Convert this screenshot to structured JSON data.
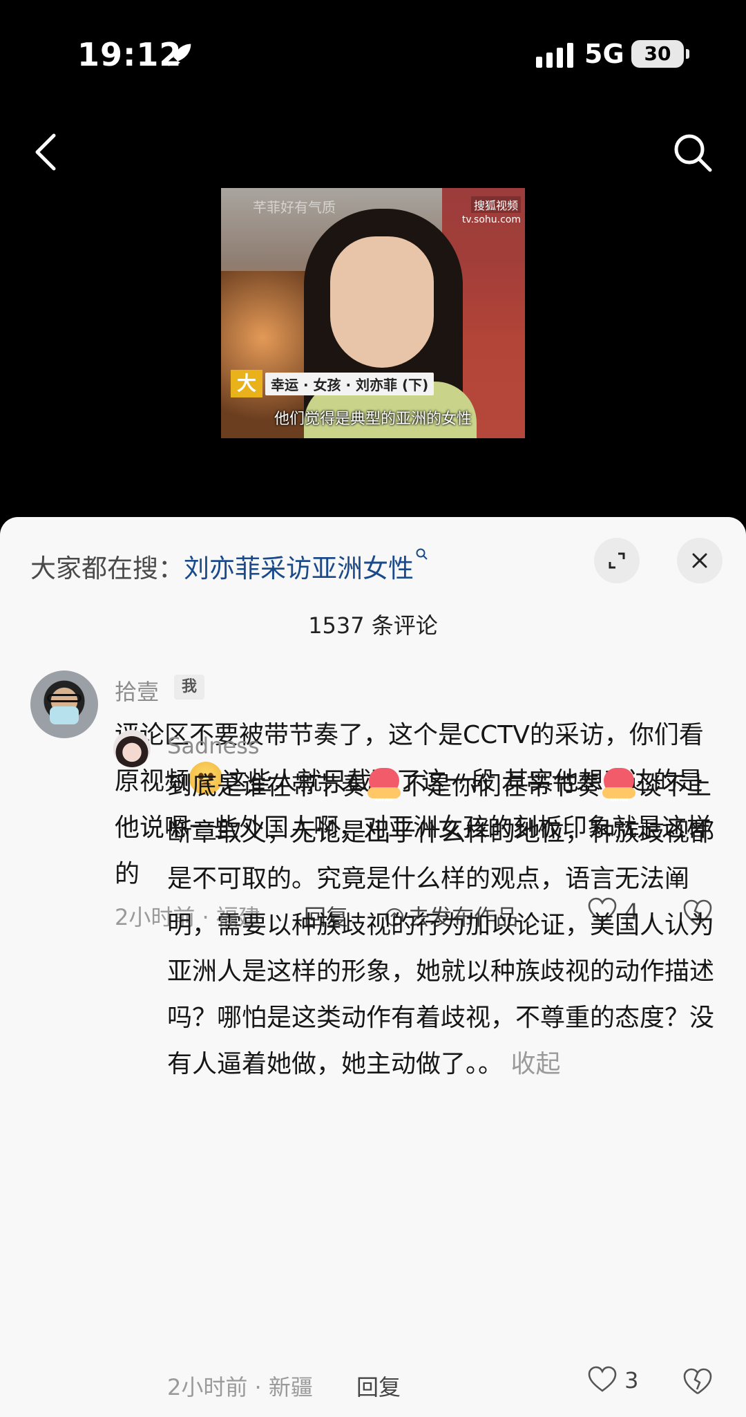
{
  "status": {
    "time": "19:12",
    "network": "5G",
    "battery": "30"
  },
  "video": {
    "subtitle": "他们觉得是典型的亚洲的女性",
    "program_title": "幸运 · 女孩 · 刘亦菲 (下)",
    "program_logo": "大",
    "watermark": "芊菲好有气质",
    "site": "tv.sohu.com",
    "site_badge": "搜狐视频"
  },
  "search": {
    "label": "大家都在搜：",
    "query": "刘亦菲采访亚洲女性"
  },
  "comment_count": "1537 条评论",
  "comments": [
    {
      "author": "拾壹",
      "badge": "我",
      "text_parts": [
        "评论区不要被带节奏了，这个是CCTV的采访，你们看原视频",
        "这些人就只截取了这一段 其实他想表达的是他说嗯一些外国人啊，对亚洲女孩的刻板印象就是这样的"
      ],
      "meta": "2小时前 · 福建",
      "reply_label": "回复",
      "publish_label": "去发布作品",
      "likes": "4"
    },
    {
      "author": "Sadness",
      "sticker_text": "加油",
      "text_parts": [
        "到底是谁在带节奏",
        "不是你们在带节奏",
        "谈不上断章取义，无论是出于什么样的地位，种族歧视都是不可取的。究竟是什么样的观点，语言无法阐明，需要以种族歧视的行为加以论证，美国人认为亚洲人是这样的形象，她就以种族歧视的动作描述吗？哪怕是这类动作有着歧视，不尊重的态度？没有人逼着她做，她主动做了。。"
      ],
      "collapse_label": "收起",
      "meta": "2小时前 · 新疆",
      "reply_label": "回复",
      "likes": "3"
    }
  ]
}
